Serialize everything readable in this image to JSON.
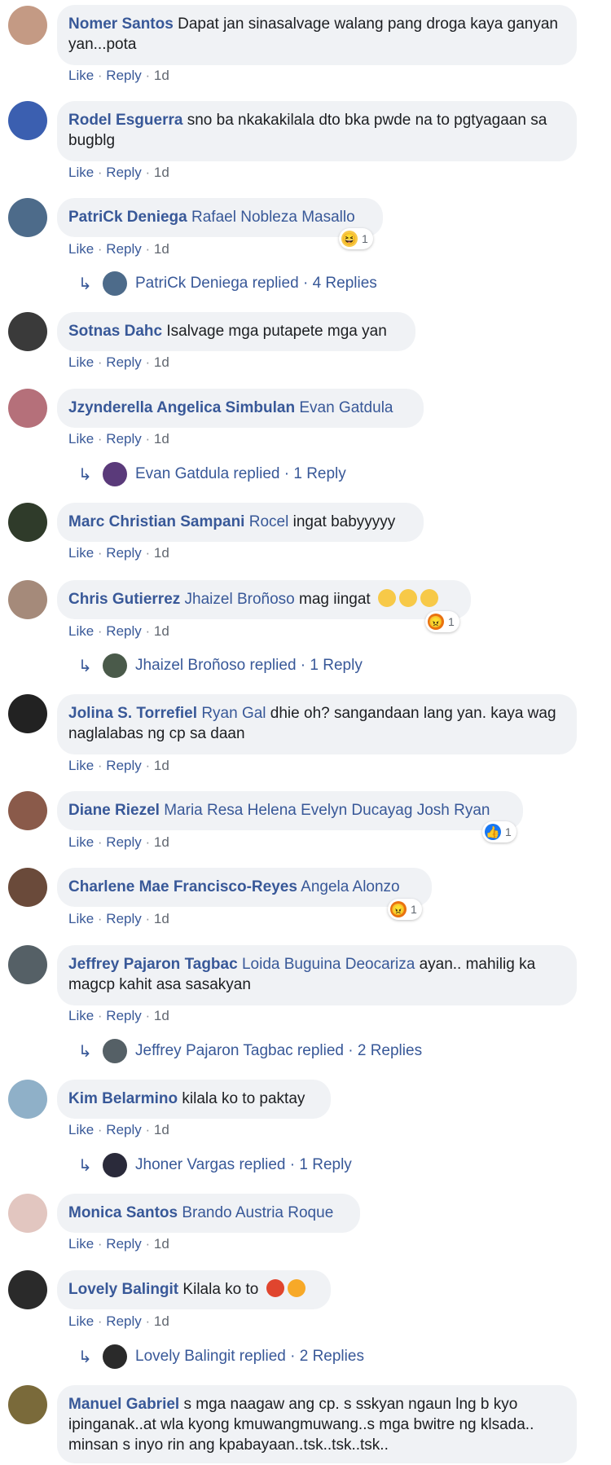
{
  "comments": [
    {
      "author": "Nomer Santos",
      "mention": "",
      "text": "Dapat jan sinasalvage walang pang droga kaya ganyan yan...pota",
      "like": "Like",
      "reply": "Reply",
      "time": "1d",
      "avatar_color": "#c49a84"
    },
    {
      "author": "Rodel Esguerra",
      "mention": "",
      "text": "sno ba nkakakilala dto bka pwde na to pgtyagaan sa bugblg",
      "like": "Like",
      "reply": "Reply",
      "time": "1d",
      "avatar_color": "#3b5fb0"
    },
    {
      "author": "PatriCk Deniega",
      "mention": "Rafael Nobleza Masallo",
      "text": "",
      "like": "Like",
      "reply": "Reply",
      "time": "1d",
      "avatar_color": "#4d6b8a",
      "reaction": {
        "icon": "laugh-emoji-icon",
        "count": "1"
      },
      "replies": {
        "name": "PatriCk Deniega replied",
        "count": "4 Replies"
      }
    },
    {
      "author": "Sotnas Dahc",
      "mention": "",
      "text": "Isalvage mga putapete mga yan",
      "like": "Like",
      "reply": "Reply",
      "time": "1d",
      "avatar_color": "#3a3a3a"
    },
    {
      "author": "Jzynderella Angelica Simbulan",
      "mention": "Evan Gatdula",
      "text": "",
      "like": "Like",
      "reply": "Reply",
      "time": "1d",
      "avatar_color": "#b5707a",
      "replies": {
        "name": "Evan Gatdula replied",
        "count": "1 Reply"
      }
    },
    {
      "author": "Marc Christian Sampani",
      "mention": "Rocel",
      "text": "ingat babyyyyy",
      "like": "Like",
      "reply": "Reply",
      "time": "1d",
      "avatar_color": "#2f3b2a"
    },
    {
      "author": "Chris Gutierrez",
      "mention": "Jhaizel Broñoso",
      "text": "mag iingat",
      "like": "Like",
      "reply": "Reply",
      "time": "1d",
      "avatar_color": "#a58a7a",
      "reaction": {
        "icon": "angry-emoji-icon",
        "count": "1"
      },
      "replies": {
        "name": "Jhaizel Broñoso replied",
        "count": "1 Reply"
      },
      "emojis": [
        "smile",
        "smile",
        "smile"
      ]
    },
    {
      "author": "Jolina S. Torrefiel",
      "mention": "Ryan Gal",
      "text": "dhie oh? sangandaan lang yan. kaya wag naglalabas ng cp sa daan",
      "like": "Like",
      "reply": "Reply",
      "time": "1d",
      "avatar_color": "#222222"
    },
    {
      "author": "Diane Riezel",
      "mention": "Maria Resa Helena Evelyn Ducayag Josh Ryan",
      "text": "",
      "like": "Like",
      "reply": "Reply",
      "time": "1d",
      "avatar_color": "#8a5a4a",
      "reaction": {
        "icon": "like-thumb-icon",
        "count": "1"
      }
    },
    {
      "author": "Charlene Mae Francisco-Reyes",
      "mention": "Angela Alonzo",
      "text": "",
      "like": "Like",
      "reply": "Reply",
      "time": "1d",
      "avatar_color": "#6a4a3a",
      "reaction": {
        "icon": "angry-emoji-icon",
        "count": "1"
      }
    },
    {
      "author": "Jeffrey Pajaron Tagbac",
      "mention": "Loida Buguina Deocariza",
      "text": "ayan.. mahilig ka magcp kahit asa sasakyan",
      "like": "Like",
      "reply": "Reply",
      "time": "1d",
      "avatar_color": "#556066",
      "replies": {
        "name": "Jeffrey Pajaron Tagbac replied",
        "count": "2 Replies"
      }
    },
    {
      "author": "Kim Belarmino",
      "mention": "",
      "text": "kilala ko to paktay",
      "like": "Like",
      "reply": "Reply",
      "time": "1d",
      "avatar_color": "#8fb0c8",
      "replies": {
        "name": "Jhoner Vargas replied",
        "count": "1 Reply"
      }
    },
    {
      "author": "Monica Santos",
      "mention": "Brando Austria Roque",
      "text": "",
      "like": "Like",
      "reply": "Reply",
      "time": "1d",
      "avatar_color": "#e2c6c0"
    },
    {
      "author": "Lovely Balingit",
      "mention": "",
      "text": "Kilala ko to",
      "like": "Like",
      "reply": "Reply",
      "time": "1d",
      "avatar_color": "#2a2a2a",
      "replies": {
        "name": "Lovely Balingit replied",
        "count": "2 Replies"
      },
      "emojis": [
        "angry",
        "frown"
      ]
    },
    {
      "author": "Manuel Gabriel",
      "mention": "",
      "text": "s mga naagaw ang cp. s sskyan ngaun lng b kyo ipinganak..at wla kyong kmuwangmuwang..s mga bwitre ng klsada.. minsan s inyo rin ang kpabayaan..tsk..tsk..tsk..",
      "like": "Like",
      "reply": "Reply",
      "time": "1d",
      "avatar_color": "#7a6a3a"
    }
  ],
  "colors": {
    "link": "#385898",
    "bubble": "#f0f2f5",
    "text": "#1c1e21",
    "meta": "#616770"
  }
}
